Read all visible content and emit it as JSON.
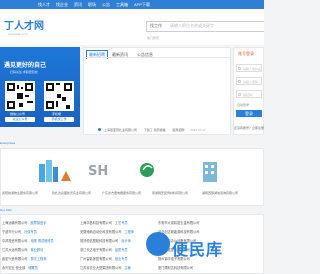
{
  "nav": {
    "items": [
      "找人才",
      "找企业",
      "资讯",
      "职场",
      "公告",
      "工具箱",
      "APP下载"
    ]
  },
  "header": {
    "logo": "丁人才网",
    "logo_sub": "rencaiw.com",
    "search_tab": "找工作",
    "search_placeholder": "请输入职位名称或关键字",
    "hot": "热门搜索"
  },
  "banner": {
    "title": "遇见更好的自己",
    "subtitle": "扫码关注 求职更轻松",
    "qr_left_cap": "微信公众号",
    "qr_right_cap": "手机端",
    "btn_left": "关注公众号",
    "btn_right": "手机找工作"
  },
  "news": {
    "tabs": [
      "最新招聘",
      "最新资讯",
      "公告信息"
    ],
    "row": {
      "company": "上海恩亚若扎业有限公司",
      "date_label": "下载了 简历模板",
      "status": "距离招聘",
      "date": "2024-07-17"
    }
  },
  "login": {
    "title": "账号登录",
    "user_placeholder": "请输入用户名",
    "pass_placeholder": "请输入密码",
    "code_placeholder": "验证码",
    "remember": "自动登录",
    "login_label": "登录",
    "register_text": "还没有账号？立即注册"
  },
  "sections": {
    "enterprises": "Enterprises",
    "jobs": "Hot Jobs"
  },
  "enterprises": [
    "贵阳技通物业服务有限公司",
    "钦扎达彩图新普实业有限公司",
    "广东省方便电器服务有限公司",
    "南通网安装饰材料有限公司",
    "湖南西部湖信咨询有限公司"
  ],
  "jobs": {
    "left": [
      {
        "co": "上海运输有限公司",
        "pos": "股票操盘手"
      },
      {
        "co": "宁波市分公司",
        "pos": "社保专员"
      },
      {
        "co": "中邦投资有限公司",
        "pos": "电视 调试维修员"
      },
      {
        "co": "江苏大运有限公司",
        "pos": "置业顾问"
      },
      {
        "co": "鑫宏兴资有限公司",
        "pos": "算法工程师"
      },
      {
        "co": "永兴宏业 营业部",
        "pos": "储蓄员"
      }
    ],
    "mid": [
      {
        "co": "上海华昌科技有限公司",
        "pos": "工艺专员"
      },
      {
        "co": "安徽博纳自动化科技有限公司",
        "pos": "工程师"
      },
      {
        "co": "常熟恒信塑胶科技有限公司",
        "pos": "设计师"
      },
      {
        "co": "浙江长达电子有限公司",
        "pos": "品质专员"
      },
      {
        "co": "广州智能家居有限公司",
        "pos": "营业专员"
      },
      {
        "co": "江苏省农业大型集团有限公司",
        "pos": "主管"
      }
    ],
    "right": [
      {
        "co": "东莞市大成精密五金有限公司"
      },
      {
        "co": "河北创达新能源科技有限公司"
      },
      {
        "co": "天津世鼎办公设备有限公司"
      },
      {
        "co": "浙江一诺塑料有限公司"
      },
      {
        "co": "扬州锦华电子有限公司"
      },
      {
        "co": "厦门顺利达科技有限公司"
      }
    ]
  },
  "watermark": "便民库",
  "colors": {
    "brand": "#2a7fd9",
    "accent": "#e45d2c"
  }
}
